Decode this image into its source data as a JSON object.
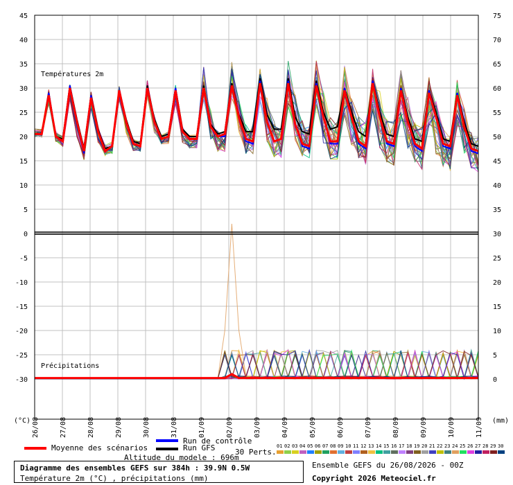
{
  "chart_data": {
    "type": "line",
    "temperature_panel": {
      "label": "Températures 2m",
      "unit_label": "(°C)",
      "ylim_left": [
        -30,
        45
      ],
      "left_ticks": [
        45,
        40,
        35,
        30,
        25,
        20,
        15,
        10,
        5,
        0,
        -5,
        -10,
        -15,
        -20,
        -25,
        -30
      ],
      "right_ticks": [
        75,
        70,
        65,
        60,
        55,
        50,
        45,
        40,
        35,
        30,
        25,
        20,
        15,
        10,
        5,
        0
      ],
      "mean_series": [
        20.5,
        20.5,
        28.5,
        20,
        19,
        30,
        23,
        17,
        28,
        21,
        17,
        18,
        29.5,
        23,
        18.5,
        18,
        30,
        23,
        19.5,
        20,
        29.5,
        21,
        19.5,
        19.5,
        30,
        22,
        20,
        20.5,
        30.5,
        24,
        19.5,
        19,
        31,
        23,
        19,
        19.5,
        31,
        22.5,
        18.5,
        18,
        30.5,
        24,
        19,
        19,
        29.5,
        24,
        19,
        18,
        31,
        24,
        19,
        18.5,
        29.5,
        23,
        18.5,
        17.5,
        29,
        24,
        18.5,
        18,
        28.5,
        22,
        17.5,
        17
      ],
      "gfs_series": [
        20.5,
        20.5,
        29,
        20,
        19.5,
        30.5,
        23.5,
        17.5,
        28.5,
        21.5,
        17.5,
        18,
        29.5,
        23.5,
        19,
        18.5,
        30.5,
        23.5,
        20,
        20.5,
        30,
        21.5,
        20,
        20,
        30.5,
        22.5,
        20.5,
        21,
        31,
        24.5,
        21,
        21,
        32,
        24.5,
        21.5,
        21.5,
        32,
        24,
        21,
        20.5,
        31.5,
        25,
        21.5,
        22,
        30,
        25,
        21,
        20,
        31.5,
        25,
        20.5,
        20,
        30,
        24,
        19.5,
        19,
        29.5,
        25,
        19.5,
        19,
        29,
        23,
        18.5,
        18
      ],
      "control_series": [
        20.5,
        20.5,
        29,
        20,
        19,
        30.5,
        23,
        16.5,
        28.5,
        21,
        17,
        18,
        29.5,
        23,
        18.5,
        18,
        30,
        23,
        19.5,
        20,
        30,
        21,
        19.5,
        19.5,
        30,
        22,
        20,
        20,
        30.5,
        24,
        19,
        18.5,
        31.5,
        23,
        19,
        19.5,
        31.5,
        22.5,
        18,
        17.5,
        31,
        24,
        18.5,
        18.5,
        30,
        24,
        18.5,
        17.5,
        31.5,
        24,
        18.5,
        18,
        30,
        23,
        18,
        17,
        29.5,
        24,
        18,
        17.5,
        29,
        22,
        17,
        16.5
      ],
      "spread_max": [
        22,
        22,
        30.5,
        21.5,
        20.5,
        31.5,
        24.5,
        19,
        30,
        23,
        19,
        19.5,
        31,
        24.5,
        20,
        19.5,
        32.5,
        25,
        21,
        21.5,
        31.5,
        23,
        21,
        21,
        36,
        27,
        22,
        22,
        37,
        29,
        24,
        24,
        36,
        30,
        25,
        24,
        38,
        31,
        25,
        24,
        38,
        32,
        26,
        25,
        37,
        30,
        27,
        25,
        36,
        32,
        26,
        25,
        36,
        31,
        25,
        24,
        35,
        30,
        24,
        23,
        34,
        28,
        23,
        22
      ],
      "spread_min": [
        19.5,
        19.5,
        26,
        18.5,
        17.5,
        27,
        19,
        14.5,
        25,
        18,
        15.5,
        16,
        27,
        20,
        16.5,
        16.5,
        27,
        20,
        18,
        18,
        26,
        18,
        17,
        17,
        26,
        18,
        16,
        16,
        26,
        19,
        15,
        15,
        25,
        17,
        14,
        14,
        24,
        17,
        14,
        14,
        24,
        16,
        13,
        13,
        22,
        16,
        13,
        12,
        23,
        15,
        12,
        12,
        21,
        15,
        12,
        11,
        20,
        14,
        11,
        11,
        20,
        14,
        11,
        10.5
      ]
    },
    "precip_panel": {
      "label": "Précipitations",
      "unit_label": "(mm)",
      "ylim": [
        0,
        30
      ],
      "peak_member": {
        "index": 23,
        "value": 32
      }
    },
    "x_dates": [
      "26/08",
      "27/08",
      "28/08",
      "29/08",
      "30/08",
      "31/08",
      "01/09",
      "02/09",
      "03/09",
      "04/09",
      "05/09",
      "06/09",
      "07/09",
      "08/09",
      "09/09",
      "10/09",
      "11/09"
    ],
    "legend": {
      "mean_label": "Moyenne des scénarios",
      "control_label": "Run de contrôle",
      "gfs_label": "Run GFS",
      "perts_label": "30 Perts.",
      "altitude_label": "Altitude du modele : 696m",
      "member_numbers": [
        "01",
        "02",
        "03",
        "04",
        "05",
        "06",
        "07",
        "08",
        "09",
        "10",
        "11",
        "12",
        "13",
        "14",
        "15",
        "16",
        "17",
        "18",
        "19",
        "20",
        "21",
        "22",
        "23",
        "24",
        "25",
        "26",
        "27",
        "28",
        "29",
        "30"
      ],
      "member_colors": [
        "#e8a030",
        "#8fd04a",
        "#d8d020",
        "#c060c0",
        "#2080ff",
        "#a0a000",
        "#20a060",
        "#e07030",
        "#60b0e0",
        "#c04040",
        "#8080ff",
        "#b06020",
        "#f0c040",
        "#00c080",
        "#40a0a0",
        "#607060",
        "#c080ff",
        "#804080",
        "#806020",
        "#a0a0a0",
        "#4040c0",
        "#c0c000",
        "#408080",
        "#e0a060",
        "#20e060",
        "#e040e0",
        "#2020a0",
        "#c02060",
        "#802020",
        "#004080"
      ]
    },
    "title_box": {
      "title": "Diagramme des ensembles GEFS sur 384h : 39.9N 0.5W",
      "subtitle": "Température 2m (°C) , précipitations (mm)"
    },
    "run_info": "Ensemble GEFS du 26/08/2026 - 00Z",
    "copyright": "Copyright 2026 Meteociel.fr",
    "colors": {
      "mean": "#ff0000",
      "control": "#0000ff",
      "gfs": "#000000",
      "grid": "#c0c0c0"
    }
  }
}
